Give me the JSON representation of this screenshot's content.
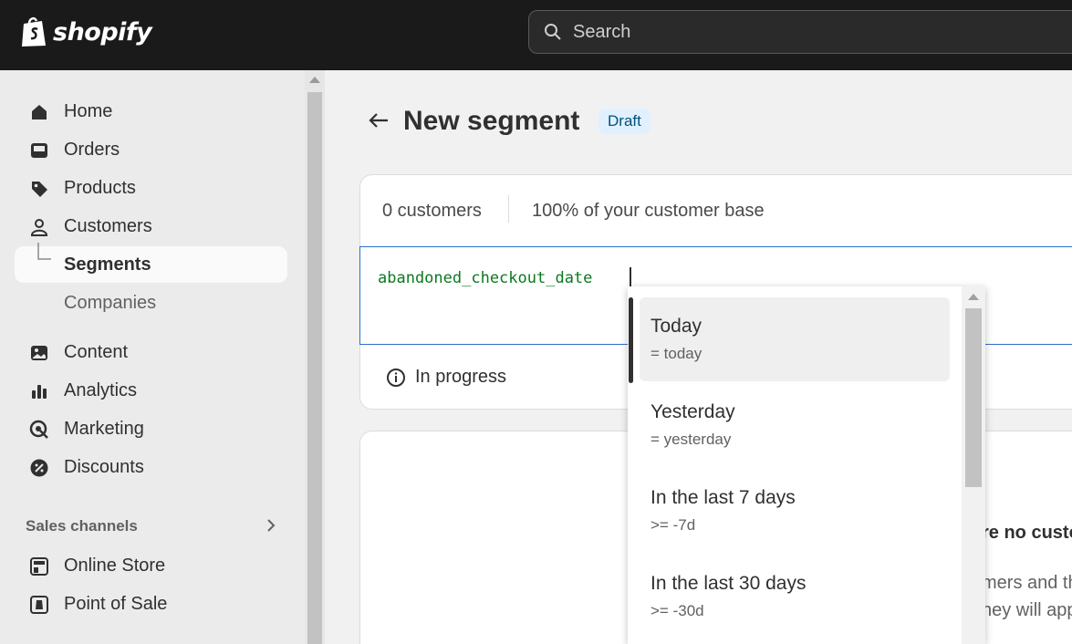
{
  "app": {
    "brand": "shopify"
  },
  "search": {
    "placeholder": "Search"
  },
  "sidebar": {
    "items": [
      {
        "label": "Home",
        "icon": "home-icon"
      },
      {
        "label": "Orders",
        "icon": "inbox-icon"
      },
      {
        "label": "Products",
        "icon": "tag-icon"
      },
      {
        "label": "Customers",
        "icon": "person-icon"
      },
      {
        "label": "Segments",
        "icon": "sub-branch-icon"
      },
      {
        "label": "Companies",
        "icon": ""
      },
      {
        "label": "Content",
        "icon": "image-icon"
      },
      {
        "label": "Analytics",
        "icon": "bar-chart-icon"
      },
      {
        "label": "Marketing",
        "icon": "target-icon"
      },
      {
        "label": "Discounts",
        "icon": "discount-icon"
      }
    ],
    "sales_channels_label": "Sales channels",
    "channels": [
      {
        "label": "Online Store",
        "icon": "store-icon"
      },
      {
        "label": "Point of Sale",
        "icon": "pos-icon"
      }
    ]
  },
  "page": {
    "title": "New segment",
    "badge": "Draft"
  },
  "summary": {
    "customers": "0 customers",
    "base": "100% of your customer base"
  },
  "editor": {
    "query": "abandoned_checkout_date"
  },
  "status": {
    "text": "In progress"
  },
  "empty_state": {
    "title": "re no custo",
    "line1": "mers and th",
    "line2": "hey will app"
  },
  "dropdown": {
    "items": [
      {
        "title": "Today",
        "sub": "= today"
      },
      {
        "title": "Yesterday",
        "sub": "= yesterday"
      },
      {
        "title": "In the last 7 days",
        "sub": ">= -7d"
      },
      {
        "title": "In the last 30 days",
        "sub": ">= -30d"
      }
    ]
  },
  "colors": {
    "accent": "#2c6ecb",
    "query_text": "#0a7a1f",
    "badge_bg": "#e0f0ff"
  }
}
